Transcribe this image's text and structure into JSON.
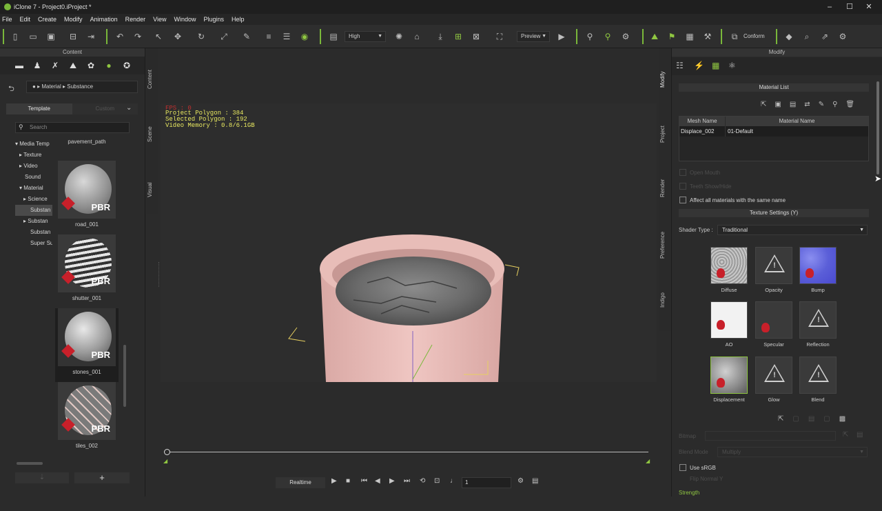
{
  "window": {
    "title": "iClone 7 - Project0.iProject *"
  },
  "menu": [
    "File",
    "Edit",
    "Create",
    "Modify",
    "Animation",
    "Render",
    "View",
    "Window",
    "Plugins",
    "Help"
  ],
  "toolbar": {
    "quality": "High",
    "preview": "Preview",
    "conform": "Conform"
  },
  "content_panel": {
    "title": "Content",
    "breadcrumb": [
      "Material",
      "Substance"
    ],
    "tabs": [
      "Template",
      "Custom"
    ],
    "search_placeholder": "Search",
    "tree": [
      "Media Temp",
      "Texture",
      "Video",
      "Sound",
      "Material",
      "Science",
      "Substan",
      "Substan",
      "Substan",
      "Super Su"
    ],
    "items": [
      {
        "label": "pavement_path"
      },
      {
        "label": "road_001",
        "badge": "PBR"
      },
      {
        "label": "shutter_001",
        "badge": "PBR"
      },
      {
        "label": "stones_001",
        "badge": "PBR"
      },
      {
        "label": "tiles_002",
        "badge": "PBR"
      }
    ],
    "side_tabs": [
      "Content",
      "Scene",
      "Visual"
    ]
  },
  "viewport": {
    "fps": "FPS : 0",
    "stats": [
      "Project Polygon : 384",
      "Selected Polygon : 192",
      "Video Memory : 0.8/6.1GB"
    ]
  },
  "playback": {
    "mode": "Realtime",
    "frame": "1"
  },
  "modify_panel": {
    "title": "Modify",
    "side_tabs": [
      "Modify",
      "Project",
      "Render",
      "Preference",
      "Indigo"
    ],
    "material_list": "Material List",
    "columns": [
      "Mesh Name",
      "Material Name"
    ],
    "rows": [
      {
        "mesh": "Displace_002",
        "material": "01-Default"
      }
    ],
    "open_mouth": "Open Mouth",
    "teeth": "Teeth Show/Hide",
    "affect_all": "Affect all materials with the same name",
    "texture_settings": "Texture Settings (Y)",
    "shader_type_label": "Shader Type :",
    "shader_type": "Traditional",
    "textures": [
      "Diffuse",
      "Opacity",
      "Bump",
      "AO",
      "Specular",
      "Reflection",
      "Displacement",
      "Glow",
      "Blend"
    ],
    "bitmap": "Bitmap",
    "blend_mode_label": "Blend Mode",
    "blend_mode": "Multiply",
    "use_srgb": "Use sRGB",
    "flip_normal": "Flip Normal Y",
    "strength": "Strength"
  },
  "colors": {
    "accent": "#8fc641",
    "warning_red": "#c8202a",
    "hud_yellow": "#e8e860"
  }
}
